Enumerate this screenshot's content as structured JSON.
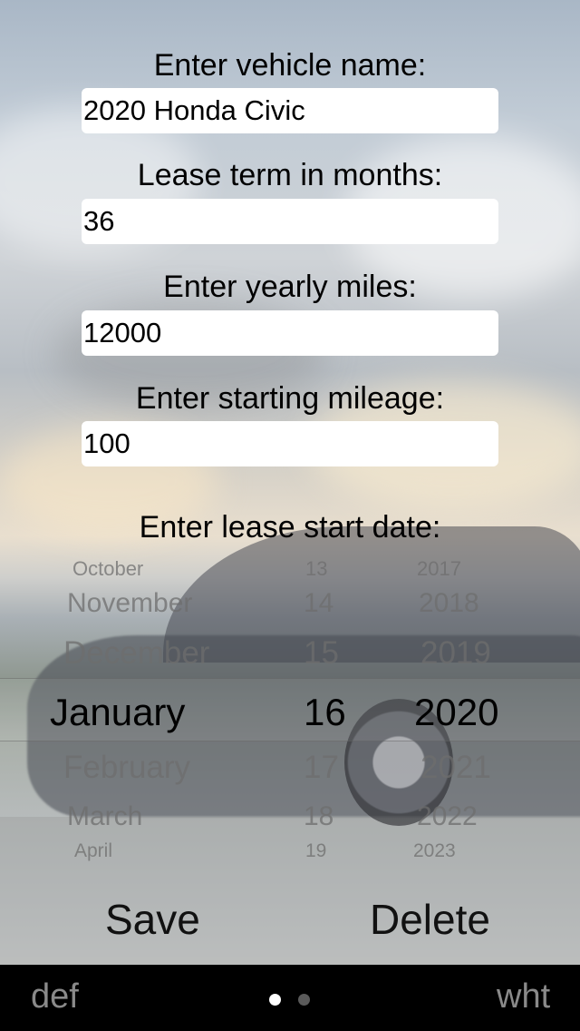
{
  "form": {
    "vehicle_name_label": "Enter vehicle name:",
    "vehicle_name_value": "2020 Honda Civic",
    "lease_term_label": "Lease term in months:",
    "lease_term_value": "36",
    "yearly_miles_label": "Enter yearly miles:",
    "yearly_miles_value": "12000",
    "starting_mileage_label": "Enter starting mileage:",
    "starting_mileage_value": "100",
    "lease_start_label": "Enter lease start date:"
  },
  "picker": {
    "month": {
      "selected": "January",
      "above": [
        "October",
        "November",
        "December"
      ],
      "below": [
        "February",
        "March",
        "April"
      ]
    },
    "day": {
      "selected": "16",
      "above": [
        "13",
        "14",
        "15"
      ],
      "below": [
        "17",
        "18",
        "19"
      ]
    },
    "year": {
      "selected": "2020",
      "above": [
        "2017",
        "2018",
        "2019"
      ],
      "below": [
        "2021",
        "2022",
        "2023"
      ]
    }
  },
  "actions": {
    "save_label": "Save",
    "delete_label": "Delete"
  },
  "tabbar": {
    "left_label": "def",
    "right_label": "wht",
    "page_count": 2,
    "current_page": 1
  }
}
